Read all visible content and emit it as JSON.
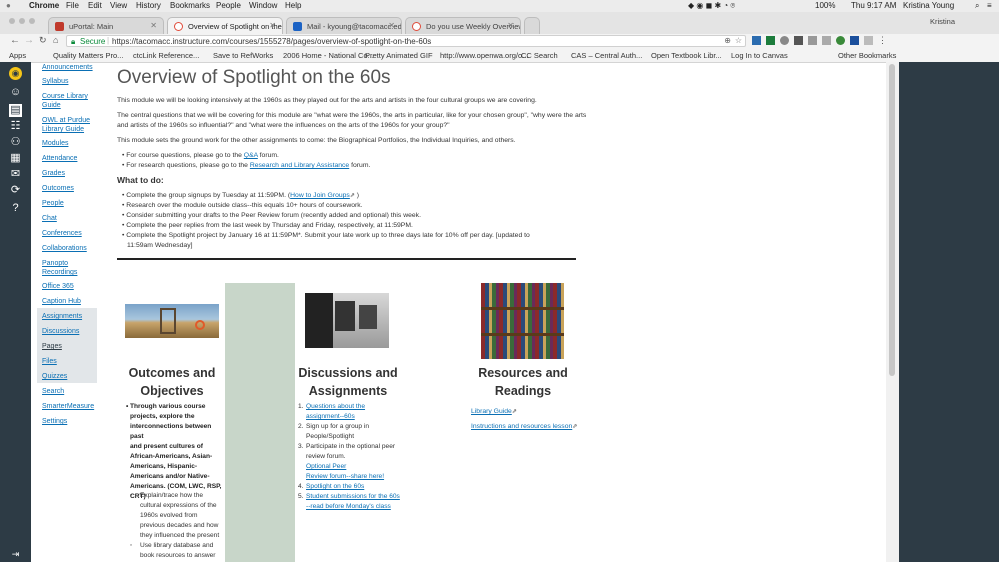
{
  "menubar": {
    "app": "Chrome",
    "items": [
      "File",
      "Edit",
      "View",
      "History",
      "Bookmarks",
      "People",
      "Window",
      "Help"
    ],
    "battery": "100%",
    "clock": "Thu 9:17 AM",
    "user": "Kristina Young"
  },
  "browser": {
    "tabs": [
      {
        "label": "uPortal: Main",
        "favicon_color": "#c0392b"
      },
      {
        "label": "Overview of Spotlight on the",
        "favicon_color": "#e04b3a"
      },
      {
        "label": "Mail - kyoung@tacomacc.edu",
        "favicon_color": "#1b62c4"
      },
      {
        "label": "Do you use Weekly Overview",
        "favicon_color": "#e04b3a"
      }
    ],
    "profile": "Kristina",
    "secure_label": "Secure",
    "url": "https://tacomacc.instructure.com/courses/1555278/pages/overview-of-spotlight-on-the-60s",
    "bookmarks": [
      "Apps",
      "Quality Matters Pro...",
      "ctcLink Reference...",
      "Save to RefWorks",
      "2006 Home - National Co...",
      "Pretty Animated GIF",
      "http://www.openwa.org/o...",
      "CC Search",
      "CAS – Central Auth...",
      "Open Textbook Libr...",
      "Log In to Canvas",
      "Other Bookmarks"
    ]
  },
  "course_nav": [
    "Announcements",
    "Syllabus",
    "Course Library Guide",
    "OWL at Purdue Library Guide",
    "Modules",
    "Attendance",
    "Grades",
    "Outcomes",
    "People",
    "Chat",
    "Conferences",
    "Collaborations",
    "Panopto Recordings",
    "Office 365",
    "Caption Hub",
    "Assignments",
    "Discussions",
    "Pages",
    "Files",
    "Quizzes",
    "Search",
    "SmarterMeasure",
    "Settings"
  ],
  "page": {
    "title": "Overview of Spotlight on the 60s",
    "intro": "This module we will be looking intensively at the 1960s as they played out for the arts and artists in the four cultural groups we are covering.",
    "central_q_line1": "The central questions that we will be covering for this module are \"what were the 1960s, the arts in particular, like for your chosen group\", \"why were the arts",
    "central_q_line2": "and artists of the 1960s so influential?\" and \"what were the influences on the arts of the 1960s for your group?\"",
    "ground_work": "This module sets the ground work for the other assignments to come: the Biographical Portfolios, the Individual Inquiries, and others.",
    "course_q_pre": "For course questions, please go to the ",
    "course_q_link": "Q&A",
    "course_q_post": " forum.",
    "research_q_pre": "For research questions, please go to the ",
    "research_q_link": "Research and Library Assistance",
    "research_q_post": " forum.",
    "todo_heading": "What to do:",
    "todo_1_pre": "Complete the group signups by Tuesday at 11:59PM. (",
    "todo_1_link": "How to Join Groups",
    "todo_1_post": " )",
    "todo_2": "Research over the module outside class--this equals 10+ hours of coursework.",
    "todo_3": "Consider submitting your drafts to the Peer Review forum (recently added and optional) this week.",
    "todo_4": "Complete the peer replies from the last week by Thursday and Friday, respectively, at 11:59PM.",
    "todo_5_line1": "Complete the Spotlight project by  January 16 at 11:59PM*.  Submit your late work up to three days late for 10% off per day. [updated to",
    "todo_5_line2": "11:59am Wednesday]"
  },
  "columns": {
    "outcomes": {
      "heading_1": "Outcomes and",
      "heading_2": "Objectives",
      "bullet_bold": [
        "Through various course",
        "projects, explore the",
        "interconnections between past",
        "and present cultures of",
        "African-Americans, Asian-",
        "Americans, Hispanic-",
        "Americans and/or Native-",
        "Americans. (COM, LWC, RSP,",
        "CRT)"
      ],
      "sub_1": [
        "Explain/trace  how the",
        "cultural expressions of the",
        "1960s evolved from",
        "previous decades and how",
        "they influenced the present"
      ],
      "sub_2": [
        "Use library database and",
        "book resources to answer"
      ]
    },
    "discussions": {
      "heading_1": "Discussions and",
      "heading_2": "Assignments",
      "item_1": [
        "Questions about the",
        "assignment--60s"
      ],
      "item_2": [
        "Sign up for a group in",
        "People/Spotlight"
      ],
      "item_3_text": [
        "Participate in the optional peer",
        "review forum. "
      ],
      "item_3_link": [
        "Optional Peer",
        "Review forum--share here!"
      ],
      "item_4": "Spotlight on the 60s",
      "item_5": [
        "Student submissions for the 60s",
        "--read before Monday's class"
      ]
    },
    "resources": {
      "heading_1": "Resources and",
      "heading_2": "Readings",
      "link_1": "Library Guide",
      "link_2": "Instructions and resources lesson"
    }
  }
}
